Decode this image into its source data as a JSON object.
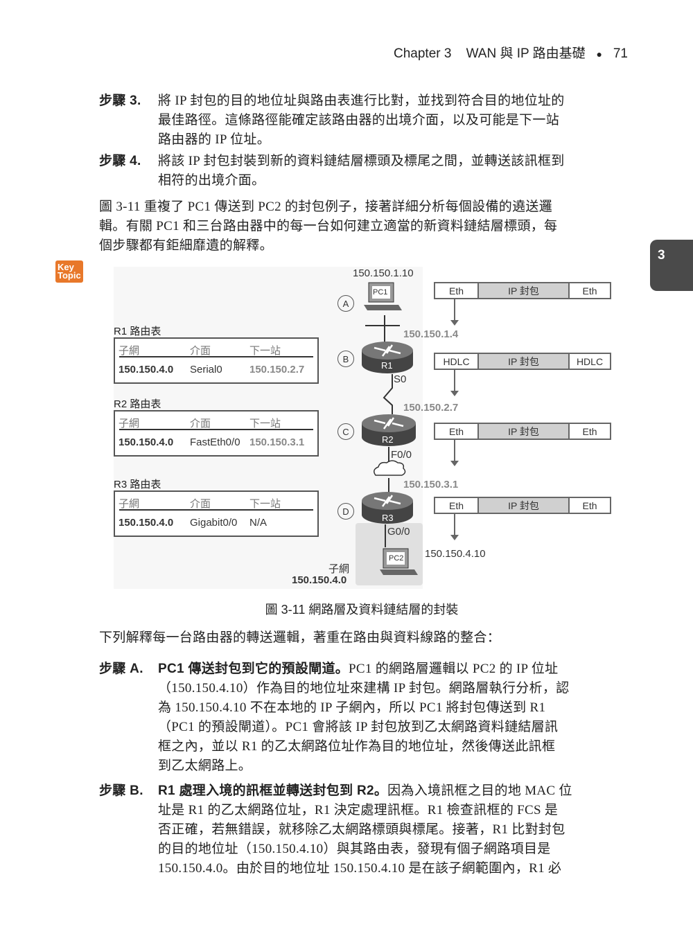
{
  "header": {
    "chapter": "Chapter 3",
    "title": "WAN 與 IP 路由基礎",
    "bullet": "●",
    "page": "71"
  },
  "side_tab": "3",
  "key_topic": [
    "Key",
    "Topic"
  ],
  "steps_top": [
    {
      "label": "步驟 3.",
      "lines": [
        "將 IP 封包的目的地位址與路由表進行比對，並找到符合目的地位址的",
        "最佳路徑。這條路徑能確定該路由器的出境介面，以及可能是下一站",
        "路由器的 IP 位址。"
      ]
    },
    {
      "label": "步驟 4.",
      "lines": [
        "將該 IP 封包封裝到新的資料鏈結層標頭及標尾之間，並轉送該訊框到",
        "相符的出境介面。"
      ]
    }
  ],
  "intro": [
    "圖 3-11 重複了 PC1 傳送到 PC2 的封包例子，接著詳細分析每個設備的遶送邏",
    "輯。有關 PC1 和三台路由器中的每一台如何建立適當的新資料鏈結層標頭，每",
    "個步驟都有鉅細靡遺的解釋。"
  ],
  "diagram": {
    "pc1": {
      "label": "PC1",
      "ip": "150.150.1.10"
    },
    "pc2": {
      "label": "PC2",
      "ip": "150.150.4.10"
    },
    "circles": [
      "A",
      "B",
      "C",
      "D"
    ],
    "routers": [
      {
        "name": "R1",
        "in_ip": "150.150.1.4",
        "out_if": "S0"
      },
      {
        "name": "R2",
        "in_ip": "150.150.2.7",
        "out_if": "F0/0"
      },
      {
        "name": "R3",
        "in_ip": "150.150.3.1",
        "out_if": "G0/0"
      }
    ],
    "frames": [
      [
        "Eth",
        "IP 封包",
        "Eth"
      ],
      [
        "HDLC",
        "IP 封包",
        "HDLC"
      ],
      [
        "Eth",
        "IP 封包",
        "Eth"
      ],
      [
        "Eth",
        "IP 封包",
        "Eth"
      ]
    ],
    "subnet_label": "子網",
    "subnet": "150.150.4.0",
    "tables": [
      {
        "title": "R1 路由表",
        "headers": [
          "子網",
          "介面",
          "下一站"
        ],
        "row": [
          "150.150.4.0",
          "Serial0",
          "150.150.2.7"
        ]
      },
      {
        "title": "R2 路由表",
        "headers": [
          "子網",
          "介面",
          "下一站"
        ],
        "row": [
          "150.150.4.0",
          "FastEth0/0",
          "150.150.3.1"
        ]
      },
      {
        "title": "R3 路由表",
        "headers": [
          "子網",
          "介面",
          "下一站"
        ],
        "row": [
          "150.150.4.0",
          "Gigabit0/0",
          "N/A"
        ]
      }
    ],
    "caption": "圖 3-11  網路層及資料鏈結層的封裝"
  },
  "after_caption": "下列解釋每一台路由器的轉送邏輯，著重在路由與資料線路的整合：",
  "steps_bottom": [
    {
      "label": "步驟 A.",
      "bold": "PC1 傳送封包到它的預設閘道。",
      "lines": [
        "PC1 的網路層邏輯以 PC2 的 IP 位址",
        "（150.150.4.10）作為目的地位址來建構 IP 封包。網路層執行分析，認",
        "為 150.150.4.10 不在本地的 IP 子網內，所以 PC1 將封包傳送到 R1",
        "（PC1 的預設閘道）。PC1 會將該 IP 封包放到乙太網路資料鏈結層訊",
        "框之內，並以 R1 的乙太網路位址作為目的地位址，然後傳送此訊框",
        "到乙太網路上。"
      ]
    },
    {
      "label": "步驟 B.",
      "bold": "R1 處理入境的訊框並轉送封包到 R2。",
      "lines": [
        "因為入境訊框之目的地 MAC 位",
        "址是 R1 的乙太網路位址，R1 決定處理訊框。R1 檢查訊框的 FCS 是",
        "否正確，若無錯誤，就移除乙太網路標頭與標尾。接著，R1 比對封包",
        "的目的地位址（150.150.4.10）與其路由表，發現有個子網路項目是",
        "150.150.4.0。由於目的地位址 150.150.4.10 是在該子網範圍內，R1 必"
      ]
    }
  ]
}
